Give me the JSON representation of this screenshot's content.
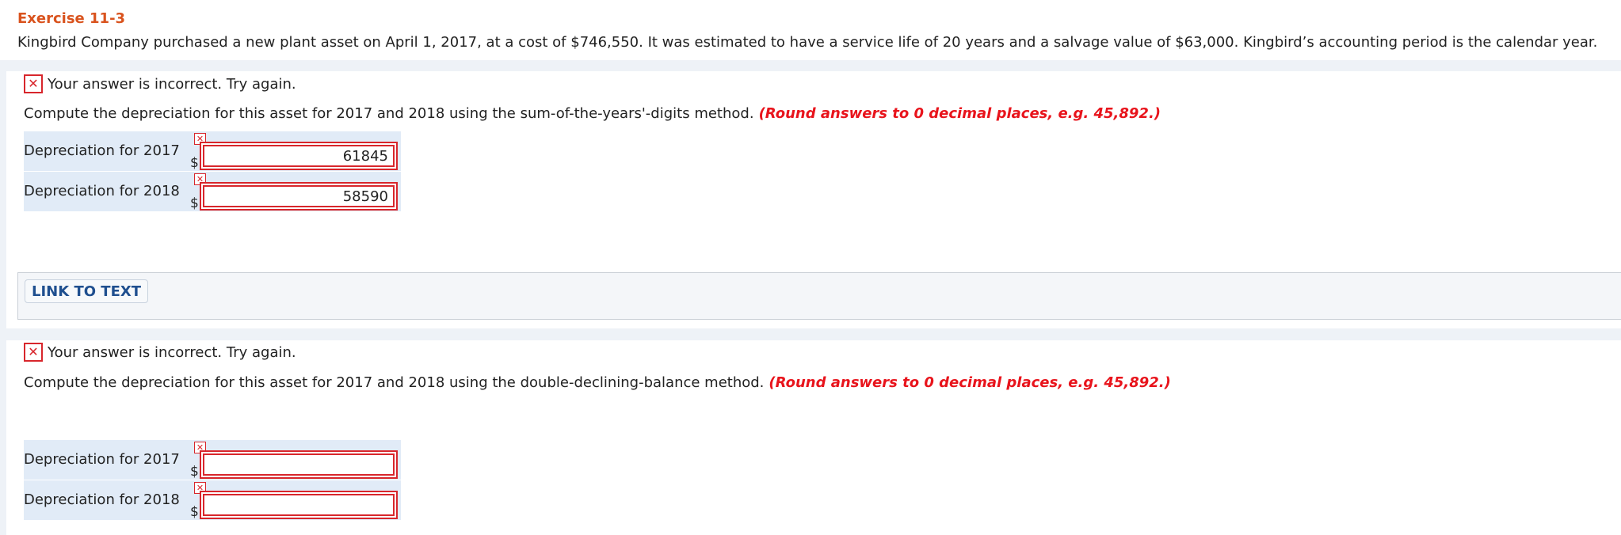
{
  "exercise": {
    "title": "Exercise 11-3",
    "problem_text": "Kingbird Company purchased a new plant asset on April 1, 2017, at a cost of $746,550. It was estimated to have a service life of 20 years and a salvage value of $63,000. Kingbird’s accounting period is the calendar year."
  },
  "part1": {
    "feedback": "Your answer is incorrect.  Try again.",
    "instruction": "Compute the depreciation for this asset for 2017 and 2018 using the sum-of-the-years'-digits method.",
    "round_note": "(Round answers to 0 decimal places, e.g. 45,892.)",
    "rows": [
      {
        "label": "Depreciation for 2017",
        "currency": "$",
        "value": "61845"
      },
      {
        "label": "Depreciation for 2018",
        "currency": "$",
        "value": "58590"
      }
    ],
    "link_button": "LINK TO TEXT"
  },
  "part2": {
    "feedback": "Your answer is incorrect.  Try again.",
    "instruction": "Compute the depreciation for this asset for 2017 and 2018 using the double-declining-balance method.",
    "round_note": "(Round answers to 0 decimal places, e.g. 45,892.)",
    "rows": [
      {
        "label": "Depreciation for 2017",
        "currency": "$",
        "value": ""
      },
      {
        "label": "Depreciation for 2018",
        "currency": "$",
        "value": ""
      }
    ]
  },
  "icons": {
    "incorrect": "x-mark-icon",
    "x_glyph": "✕"
  },
  "colors": {
    "title": "#d9531e",
    "error_red": "#d8262c",
    "round_note": "#e8141c",
    "row_bg": "#e1ebf7",
    "link_text": "#1f4f8f"
  }
}
